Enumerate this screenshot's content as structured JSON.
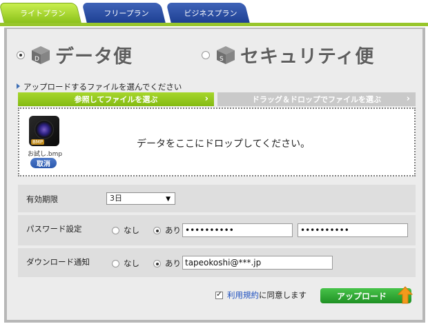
{
  "tabs": [
    {
      "label": "ライトプラン"
    },
    {
      "label": "フリープラン"
    },
    {
      "label": "ビジネスプラン"
    }
  ],
  "service": {
    "data_label": "データ便",
    "security_label": "セキュリティ便",
    "selected": "data"
  },
  "upload": {
    "section_label": "アップロードするファイルを選んでください",
    "browse_label": "参照してファイルを選ぶ",
    "drag_label": "ドラッグ＆ドロップでファイルを選ぶ",
    "drop_text": "データをここにドロップしてください。",
    "file_name": "お試し.bmp",
    "file_badge": "BMP",
    "cancel_label": "取消"
  },
  "options": {
    "expiry_label": "有効期限",
    "expiry_value": "3日",
    "password_label": "パスワード設定",
    "password_value": "••••••••••",
    "password_confirm_value": "••••••••••",
    "notify_label": "ダウンロード通知",
    "notify_email": "tapeokoshi@***.jp",
    "none_label": "なし",
    "yes_label": "あり"
  },
  "footer": {
    "terms_link": "利用規約",
    "terms_suffix": "に同意します",
    "terms_checked": true,
    "upload_label": "アップロード"
  },
  "colors": {
    "accent_green": "#8cc21b",
    "tab_blue": "#1d3f92",
    "upload_green": "#2aa02e",
    "upload_arrow": "#f39a1c"
  }
}
